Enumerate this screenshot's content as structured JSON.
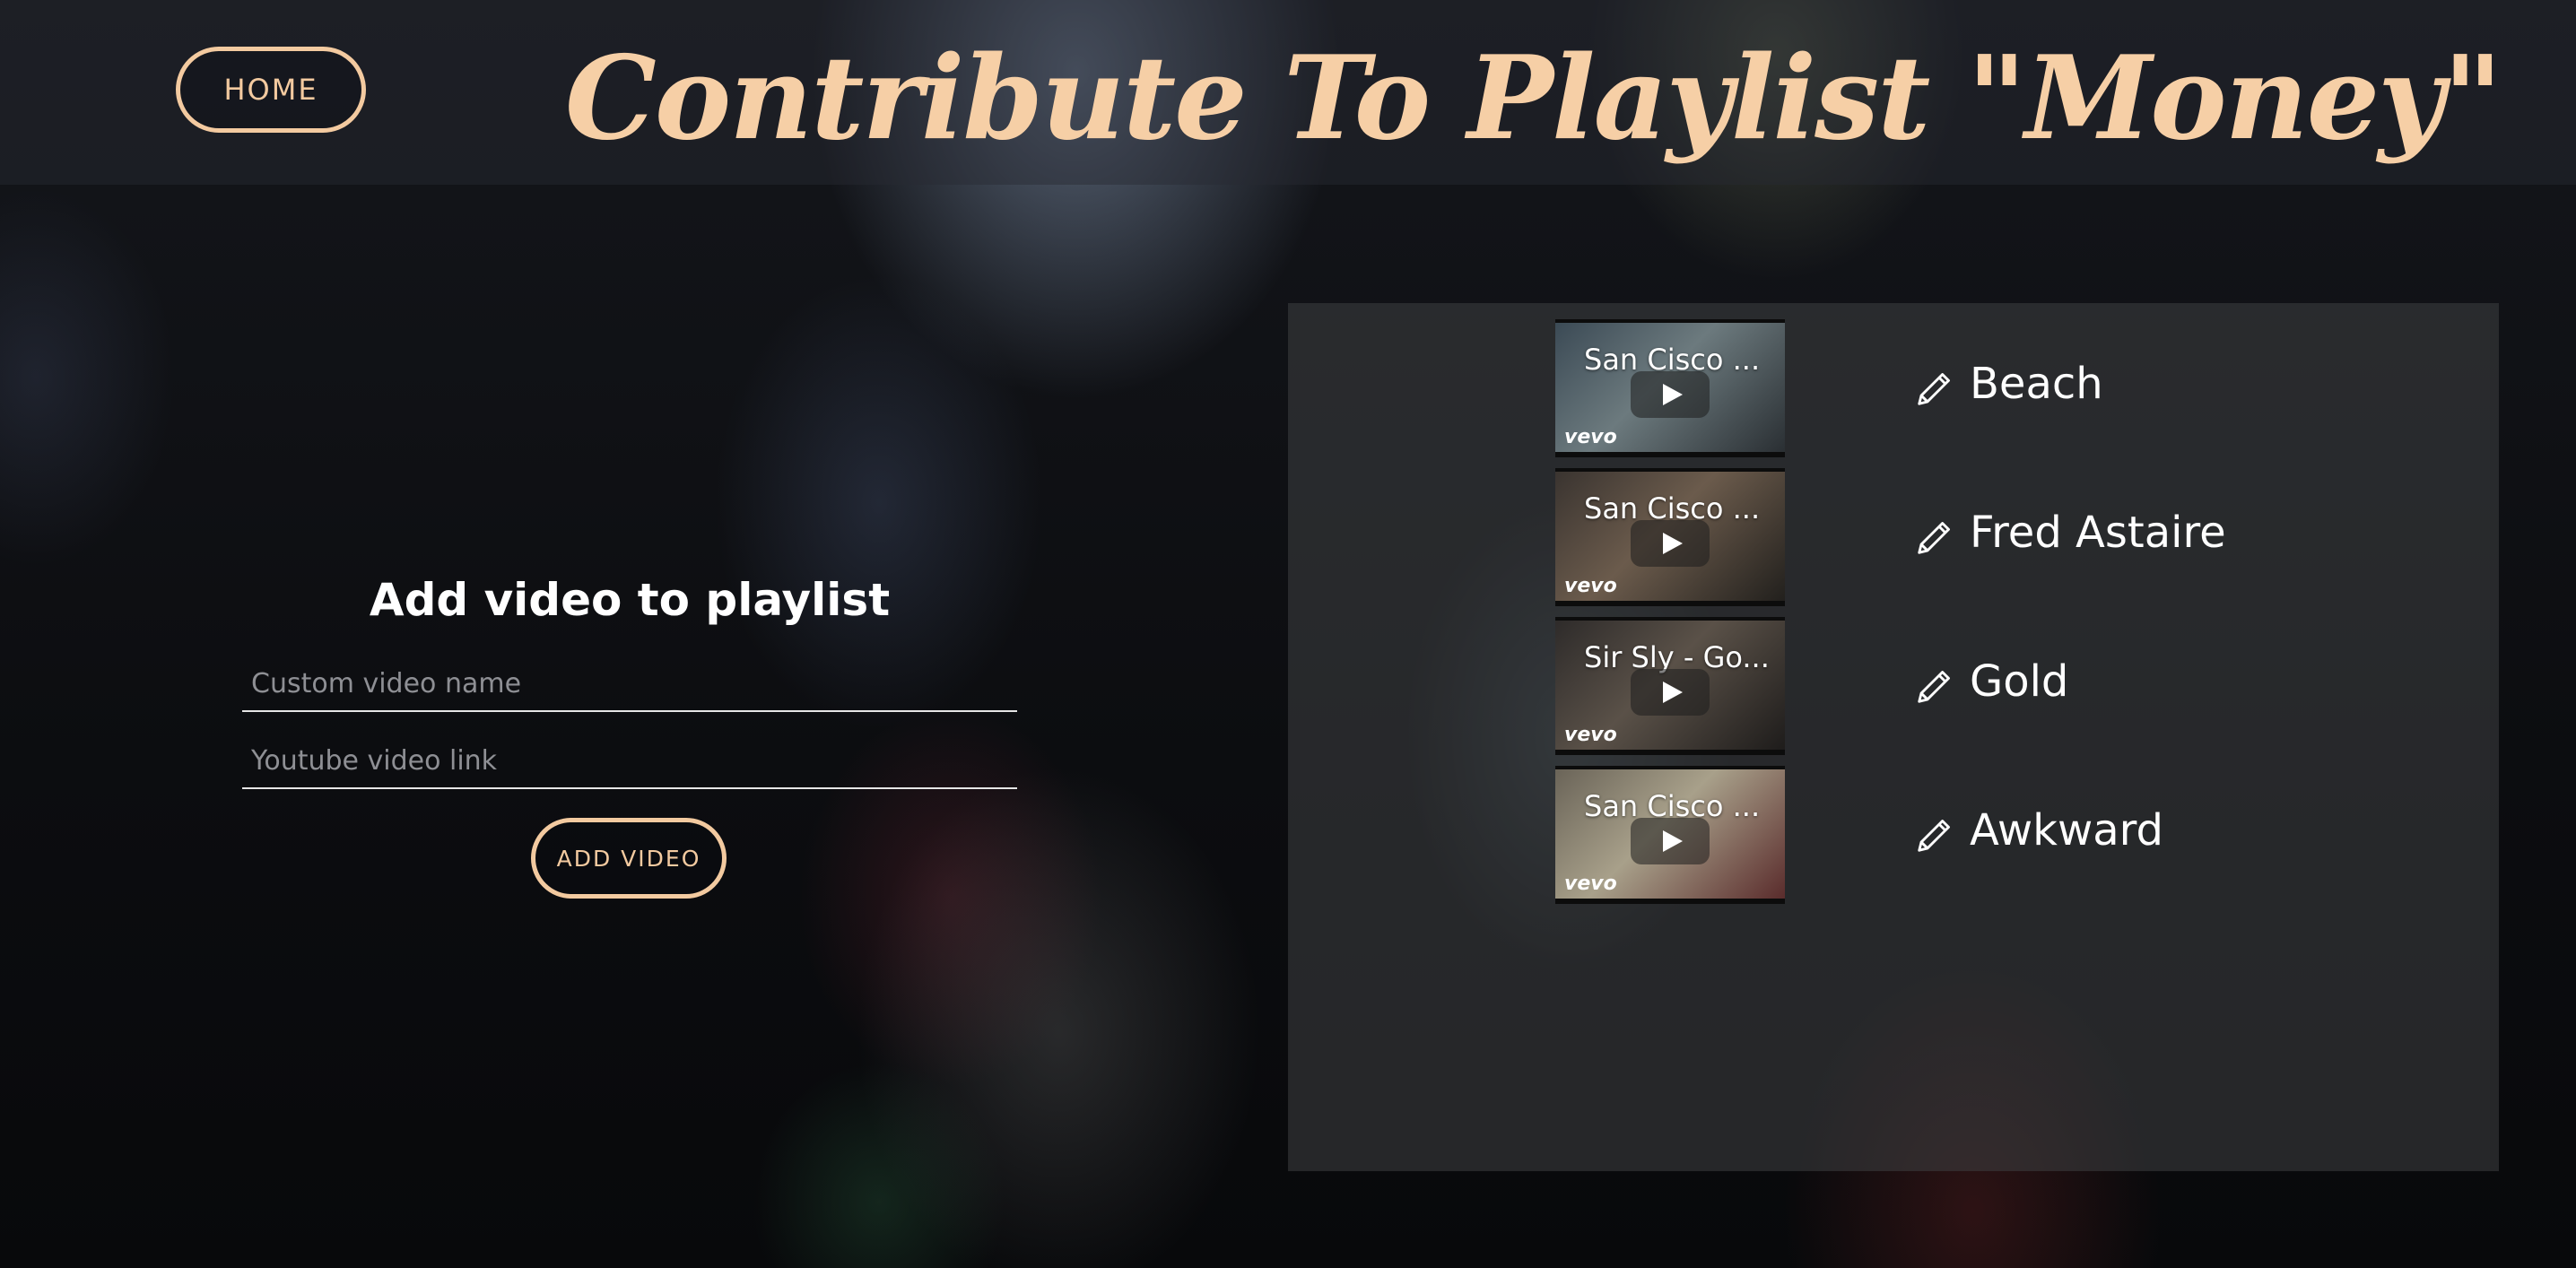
{
  "header": {
    "home_label": "HOME",
    "title": "Contribute To Playlist \"Money\""
  },
  "form": {
    "title": "Add video to playlist",
    "name_placeholder": "Custom video name",
    "name_value": "",
    "link_placeholder": "Youtube video link",
    "link_value": "",
    "submit_label": "ADD VIDEO"
  },
  "playlist": {
    "videos": [
      {
        "thumb_title": "San Cisco ...",
        "name": "Beach",
        "logo": "vevo",
        "thumb_colors": [
          "#3b4a55",
          "#6c7a7e",
          "#2a2f33"
        ]
      },
      {
        "thumb_title": "San Cisco ...",
        "name": "Fred Astaire",
        "logo": "vevo",
        "thumb_colors": [
          "#3a3430",
          "#6b5b4c",
          "#22201d"
        ]
      },
      {
        "thumb_title": "Sir Sly - Go...",
        "name": "Gold",
        "logo": "vevo",
        "thumb_colors": [
          "#2e2b2a",
          "#5a5148",
          "#1e1c1b"
        ]
      },
      {
        "thumb_title": "San Cisco ...",
        "name": "Awkward",
        "logo": "vevo",
        "thumb_colors": [
          "#6a6458",
          "#a8a08a",
          "#5a2c2c"
        ]
      }
    ]
  },
  "icons": {
    "edit": "pencil-icon",
    "play": "play-icon"
  },
  "colors": {
    "accent": "#f3caa0",
    "panel": "#3e3f42",
    "text": "#ffffff"
  }
}
